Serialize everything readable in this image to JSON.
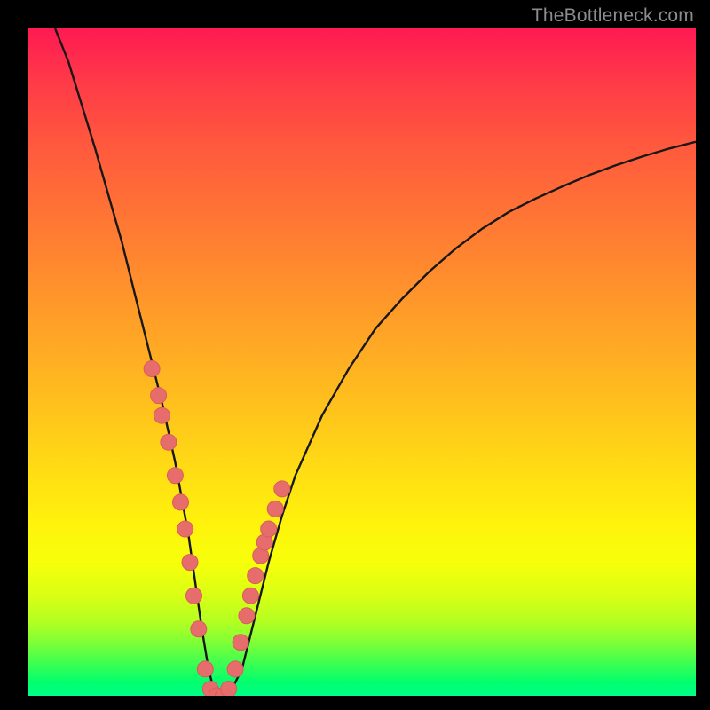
{
  "watermark": {
    "text": "TheBottleneck.com"
  },
  "colors": {
    "curve_stroke": "#181818",
    "dot_fill": "#e76d6d",
    "dot_stroke": "#d85c5c"
  },
  "chart_data": {
    "type": "line",
    "title": "",
    "xlabel": "",
    "ylabel": "",
    "xlim": [
      0,
      100
    ],
    "ylim": [
      0,
      100
    ],
    "series": [
      {
        "name": "bottleneck-curve",
        "x": [
          4,
          6,
          8,
          10,
          12,
          14,
          16,
          18,
          20,
          22,
          24,
          25,
          26,
          27,
          28,
          29,
          30,
          32,
          34,
          36,
          38,
          40,
          44,
          48,
          52,
          56,
          60,
          64,
          68,
          72,
          76,
          80,
          84,
          88,
          92,
          96,
          100
        ],
        "y": [
          100,
          95,
          88.5,
          82,
          75,
          68,
          60,
          52,
          44,
          35,
          24,
          17,
          10,
          4,
          0,
          0,
          0,
          4,
          12,
          20,
          27,
          33,
          42,
          49,
          55,
          59.5,
          63.5,
          67,
          70,
          72.5,
          74.5,
          76.3,
          78,
          79.5,
          80.8,
          82,
          83
        ]
      }
    ],
    "dots": {
      "name": "highlight-dots",
      "x": [
        18.5,
        19.5,
        20,
        21,
        22,
        22.8,
        23.5,
        24.2,
        24.8,
        25.5,
        26.5,
        27.3,
        28.2,
        29.2,
        30,
        31,
        31.8,
        32.7,
        33.3,
        34,
        34.8,
        35.4,
        36,
        37,
        38
      ],
      "y": [
        49,
        45,
        42,
        38,
        33,
        29,
        25,
        20,
        15,
        10,
        4,
        1,
        0,
        0,
        1,
        4,
        8,
        12,
        15,
        18,
        21,
        23,
        25,
        28,
        31
      ]
    }
  }
}
